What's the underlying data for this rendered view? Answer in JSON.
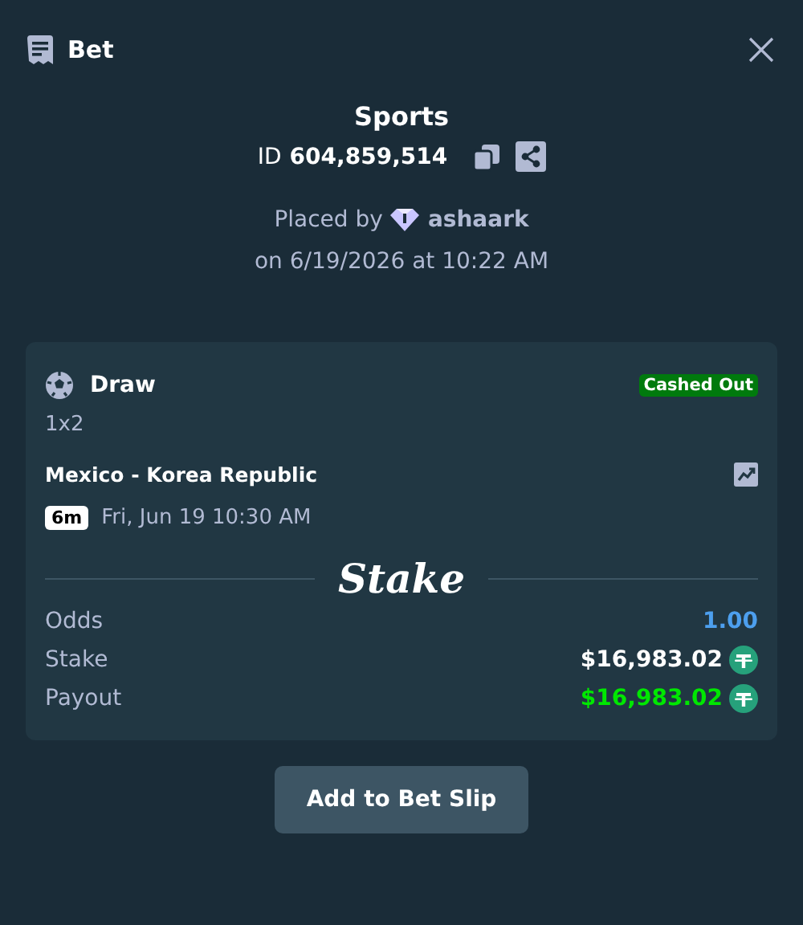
{
  "header": {
    "title": "Bet"
  },
  "bet": {
    "category": "Sports",
    "id_label": "ID",
    "id_value": "604,859,514",
    "placed_by_label": "Placed by",
    "user": "ashaark",
    "placed_on": "on 6/19/2026 at 10:22 AM"
  },
  "selection": {
    "outcome": "Draw",
    "status": "Cashed Out",
    "market": "1x2",
    "event": "Mexico - Korea Republic",
    "live_badge": "6m",
    "event_time": "Fri, Jun 19  10:30 AM"
  },
  "logo": "Stake",
  "summary": [
    {
      "kind": "odds",
      "label": "Odds",
      "value": "1.00"
    },
    {
      "kind": "stake",
      "label": "Stake",
      "value": "$16,983.02"
    },
    {
      "kind": "payout",
      "label": "Payout",
      "value": "$16,983.02"
    }
  ],
  "buttons": [
    "Add to Bet Slip"
  ]
}
